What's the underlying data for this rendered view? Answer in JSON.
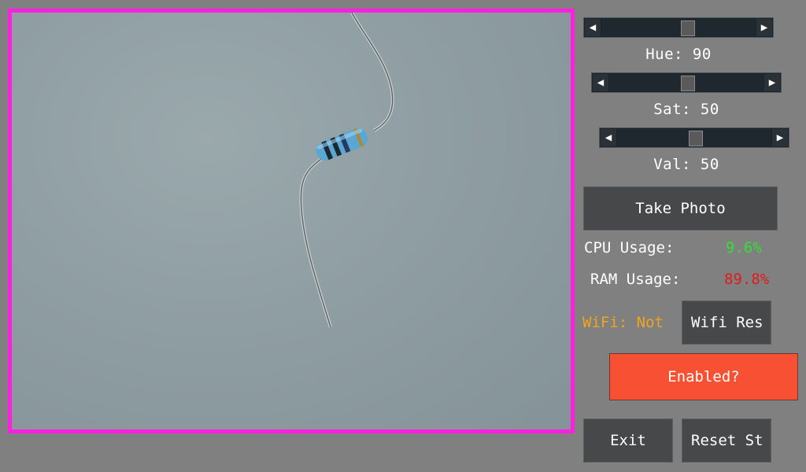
{
  "sliders": [
    {
      "label": "Hue: 90",
      "value_fraction": 0.5
    },
    {
      "label": "Sat: 50",
      "value_fraction": 0.5
    },
    {
      "label": "Val: 50",
      "value_fraction": 0.5
    }
  ],
  "arrows": {
    "left": "◀",
    "right": "▶"
  },
  "buttons": {
    "take_photo": "Take Photo",
    "wifi_reset": "Wifi Res",
    "enabled": "Enabled?",
    "exit": "Exit",
    "reset": "Reset St"
  },
  "stats": {
    "cpu_label": "CPU Usage:",
    "cpu_value": "9.6%",
    "ram_label": "RAM Usage:",
    "ram_value": "89.8%",
    "wifi": "WiFi: Not"
  },
  "colors": {
    "preview_border": "#ff1fe0",
    "cpu_value": "#33e033",
    "ram_value": "#e01b1b",
    "wifi": "#f2a51a",
    "enabled_button": "#f85032"
  }
}
